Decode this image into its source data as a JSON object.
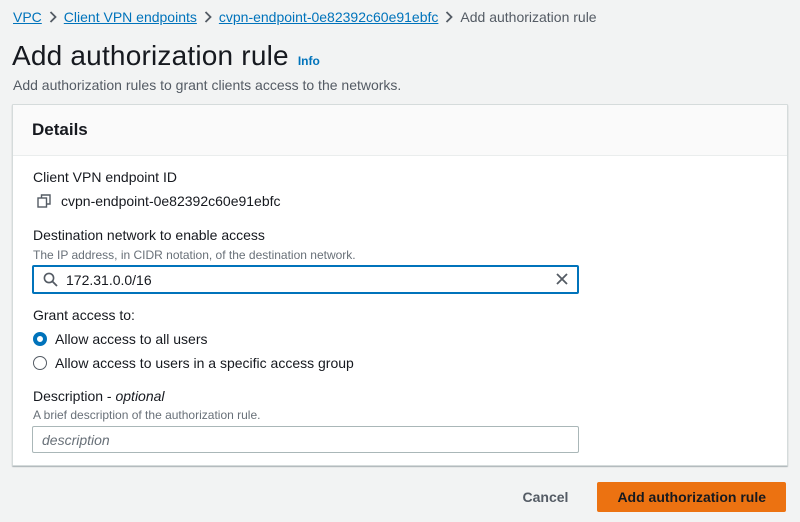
{
  "breadcrumb": {
    "items": [
      "VPC",
      "Client VPN endpoints",
      "cvpn-endpoint-0e82392c60e91ebfc"
    ],
    "current": "Add authorization rule"
  },
  "header": {
    "title": "Add authorization rule",
    "info": "Info",
    "description": "Add authorization rules to grant clients access to the networks."
  },
  "panel": {
    "title": "Details",
    "endpoint": {
      "label": "Client VPN endpoint ID",
      "value": "cvpn-endpoint-0e82392c60e91ebfc",
      "icon": "copy-icon"
    },
    "destination": {
      "label": "Destination network to enable access",
      "hint": "The IP address, in CIDR notation, of the destination network.",
      "value": "172.31.0.0/16",
      "icon": "search-icon",
      "clear_icon": "clear-icon"
    },
    "grant": {
      "label": "Grant access to:",
      "options": [
        {
          "label": "Allow access to all users",
          "checked": true
        },
        {
          "label": "Allow access to users in a specific access group",
          "checked": false
        }
      ]
    },
    "description_field": {
      "label": "Description",
      "label_suffix": "optional",
      "hint": "A brief description of the authorization rule.",
      "placeholder": "description",
      "value": ""
    }
  },
  "actions": {
    "cancel": "Cancel",
    "submit": "Add authorization rule"
  },
  "colors": {
    "link": "#0073bb",
    "primary_button": "#ec7211",
    "focus_border": "#0073bb",
    "background": "#f2f3f3"
  }
}
